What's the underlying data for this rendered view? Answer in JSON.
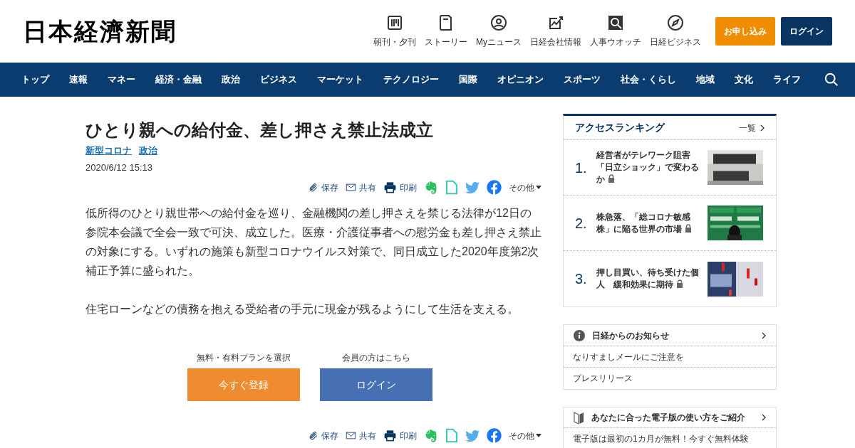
{
  "logo": "日本経濟新聞",
  "header_links": [
    {
      "kind": "newspaper",
      "label": "朝刊・夕刊"
    },
    {
      "kind": "book",
      "label": "ストーリー"
    },
    {
      "kind": "person",
      "label": "Myニュース"
    },
    {
      "kind": "chart",
      "label": "日経会社情報"
    },
    {
      "kind": "magnifier",
      "label": "人事ウオッチ"
    },
    {
      "kind": "compass",
      "label": "日経ビジネス"
    }
  ],
  "header_buttons": [
    {
      "kind": "primary",
      "label": "お申し込み"
    },
    {
      "kind": "secondary",
      "label": "ログイン"
    }
  ],
  "nav": [
    "トップ",
    "速報",
    "マネー",
    "経済・金融",
    "政治",
    "ビジネス",
    "マーケット",
    "テクノロジー",
    "国際",
    "オピニオン",
    "スポーツ",
    "社会・くらし",
    "地域",
    "文化",
    "ライフ"
  ],
  "article": {
    "title": "ひとり親への給付金、差し押さえ禁止法成立",
    "tags": [
      "新型コロナ",
      "政治"
    ],
    "date": "2020/6/12 15:13",
    "share_top": [
      {
        "kind": "save",
        "label": "保存"
      },
      {
        "kind": "mail",
        "label": "共有"
      },
      {
        "kind": "print",
        "label": "印刷"
      },
      {
        "kind": "evernote"
      },
      {
        "kind": "note"
      },
      {
        "kind": "twitter"
      },
      {
        "kind": "facebook"
      },
      {
        "kind": "more",
        "label": "その他"
      }
    ],
    "paragraphs": [
      "低所得のひとり親世帯への給付金を巡り、金融機関の差し押さえを禁じる法律が12日の参院本会議で全会一致で可決、成立した。医療・介護従事者への慰労金も差し押さえ禁止の対象にする。いずれの施策も新型コロナウイルス対策で、同日成立した2020年度第2次補正予算に盛られた。",
      "住宅ローンなどの債務を抱える受給者の手元に現金が残るようにして生活を支える。"
    ],
    "paywall": [
      {
        "kind": "register",
        "caption": "無料・有料プランを選択",
        "button": "今すぐ登録"
      },
      {
        "kind": "login",
        "caption": "会員の方はこちら",
        "button": "ログイン"
      }
    ],
    "share_bottom": [
      {
        "kind": "save",
        "label": "保存"
      },
      {
        "kind": "mail",
        "label": "共有"
      },
      {
        "kind": "print",
        "label": "印刷"
      },
      {
        "kind": "evernote"
      },
      {
        "kind": "note"
      },
      {
        "kind": "twitter"
      },
      {
        "kind": "facebook"
      },
      {
        "kind": "more",
        "label": "その他"
      }
    ]
  },
  "ranking": {
    "title": "アクセスランキング",
    "more": "一覧",
    "items": [
      {
        "rank": "1.",
        "title": "経営者がテレワーク阻害「日立ショック」で変わるか",
        "locked": true
      },
      {
        "rank": "2.",
        "title": "株急落、「総コロナ敏感株」に陥る世界の市場",
        "locked": true
      },
      {
        "rank": "3.",
        "title": "押し目買い、待ち受けた個人　緩和効果に期待",
        "locked": true
      }
    ]
  },
  "notices": {
    "title": "日経からのお知らせ",
    "items": [
      "なりすましメールにご注意を",
      "プレスリリース"
    ]
  },
  "guide": {
    "title": "あなたに合った電子版の使い方をご紹介",
    "items": [
      "電子版は最初の1カ月が無料！今すぐ無料体験"
    ]
  }
}
